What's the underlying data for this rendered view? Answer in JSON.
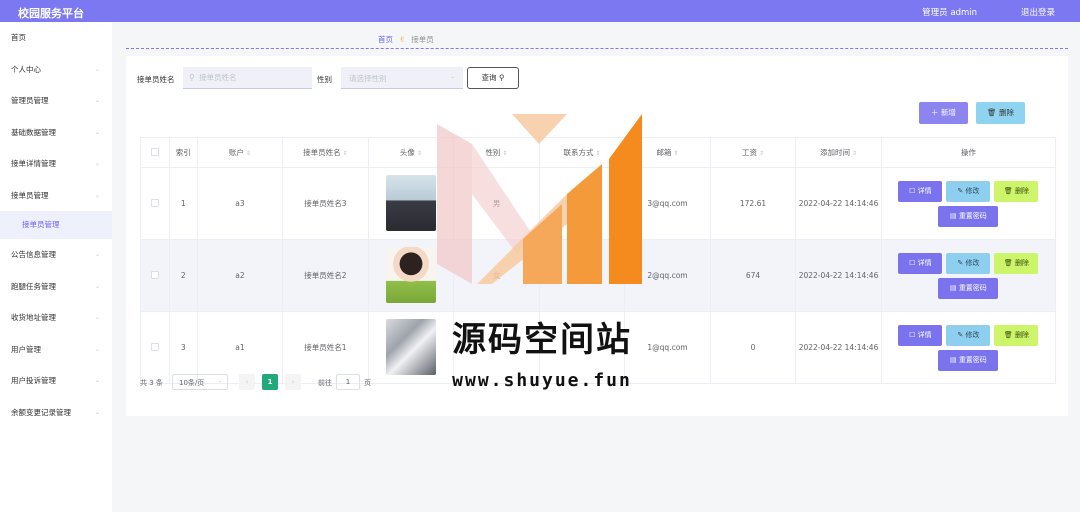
{
  "header": {
    "title": "校园服务平台",
    "user": "管理员 admin",
    "logout": "退出登录"
  },
  "sidebar": {
    "items": [
      {
        "label": "首页",
        "chevron": false
      },
      {
        "label": "个人中心",
        "chevron": true
      },
      {
        "label": "管理员管理",
        "chevron": true
      },
      {
        "label": "基础数据管理",
        "chevron": true
      },
      {
        "label": "接单详情管理",
        "chevron": true
      },
      {
        "label": "接单员管理",
        "chevron": true
      },
      {
        "label": "接单员管理",
        "sub": true
      },
      {
        "label": "公告信息管理",
        "chevron": true
      },
      {
        "label": "跑腿任务管理",
        "chevron": true
      },
      {
        "label": "收货地址管理",
        "chevron": true
      },
      {
        "label": "用户管理",
        "chevron": true
      },
      {
        "label": "用户投诉管理",
        "chevron": true
      },
      {
        "label": "余额变更记录管理",
        "chevron": true
      }
    ]
  },
  "breadcrumb": {
    "home": "首页",
    "current": "接单员"
  },
  "search": {
    "name_label": "接单员姓名",
    "name_placeholder": "接单员姓名",
    "gender_label": "性别",
    "gender_placeholder": "请选择性别",
    "query_button": "查询"
  },
  "actions": {
    "add": "新增",
    "delete": "删除"
  },
  "table": {
    "columns": [
      "",
      "索引",
      "账户",
      "接单员姓名",
      "头像",
      "性别",
      "联系方式",
      "邮箱",
      "工资",
      "添加时间",
      "操作"
    ],
    "sortable": [
      false,
      false,
      true,
      true,
      true,
      true,
      true,
      true,
      true,
      true,
      false
    ],
    "rows": [
      {
        "index": "1",
        "account": "a3",
        "name": "接单员姓名3",
        "avatar": "av1",
        "gender": "男",
        "phone": "86",
        "email": "3@qq.com",
        "salary": "172.61",
        "time": "2022-04-22 14:14:46"
      },
      {
        "index": "2",
        "account": "a2",
        "name": "接单员姓名2",
        "avatar": "av2",
        "gender": "女",
        "phone": "86",
        "email": "2@qq.com",
        "salary": "674",
        "time": "2022-04-22 14:14:46"
      },
      {
        "index": "3",
        "account": "a1",
        "name": "接单员姓名1",
        "avatar": "av3",
        "gender": "",
        "phone": "",
        "email": "1@qq.com",
        "salary": "0",
        "time": "2022-04-22 14:14:46"
      }
    ],
    "row_ops": {
      "detail": "详情",
      "edit": "修改",
      "delete": "删除",
      "reset": "重置密码"
    }
  },
  "pagination": {
    "total": "共 3 条",
    "page_size": "10条/页",
    "current": "1",
    "goto": "前往",
    "goto_value": "1",
    "unit": "页"
  },
  "watermark": {
    "title": "源码空间站",
    "url": "www.shuyue.fun"
  },
  "colors": {
    "topbar": "#7b78f2",
    "accent": "#6c63ff",
    "page_active": "#21a97a"
  }
}
